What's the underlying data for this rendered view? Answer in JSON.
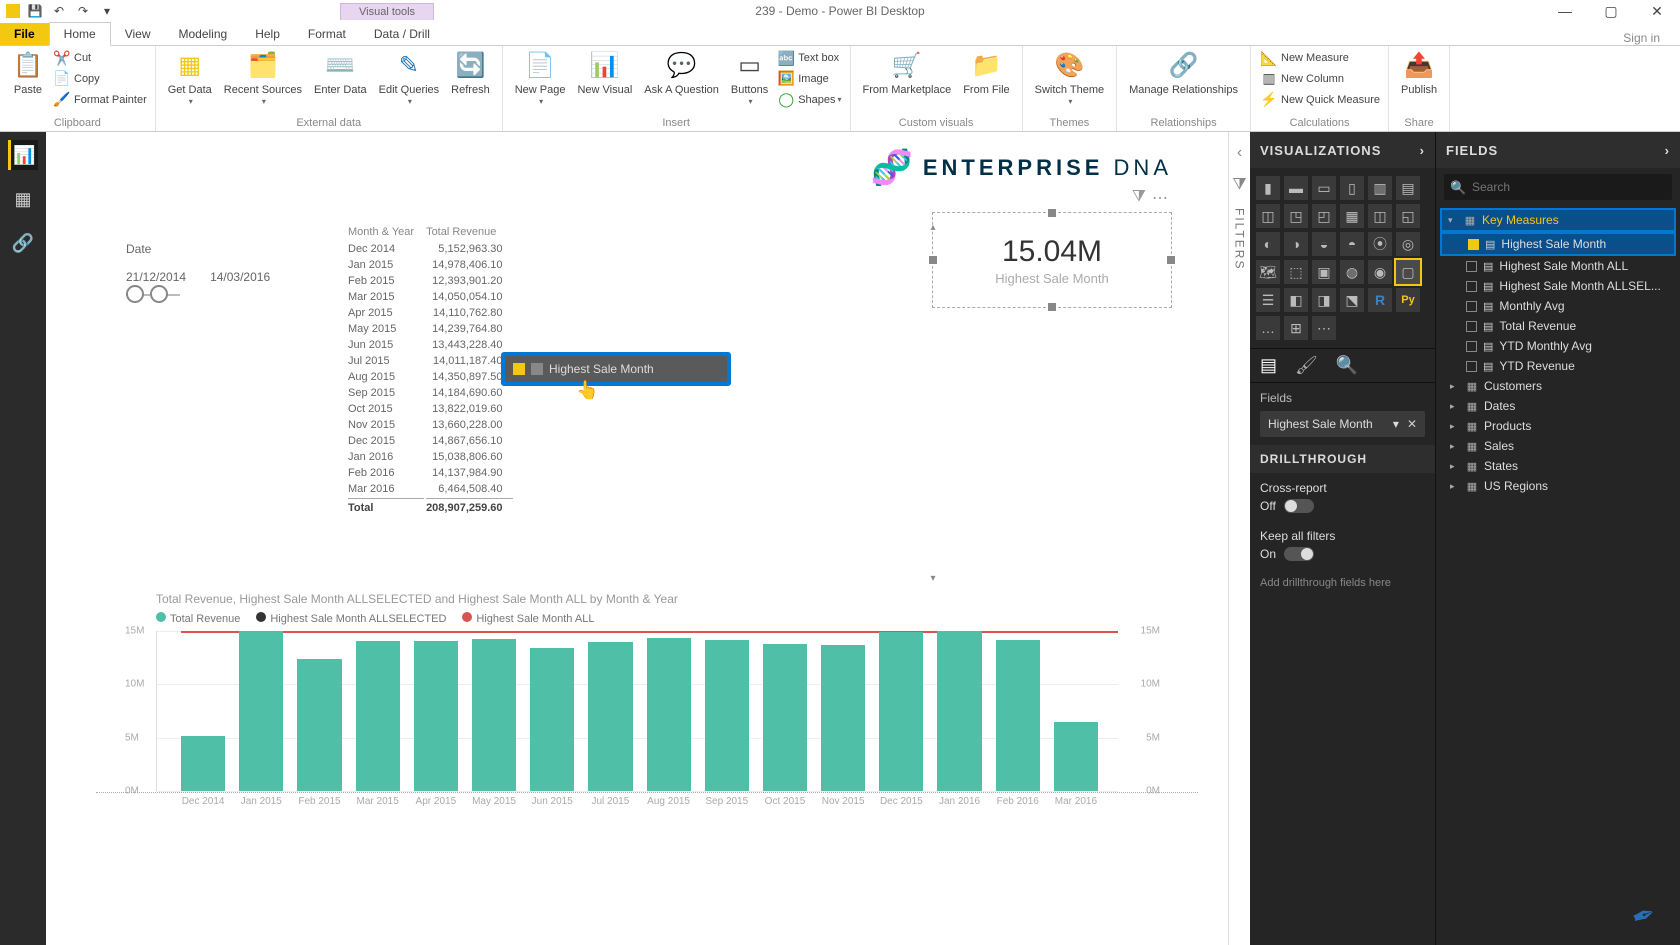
{
  "title": {
    "context": "Visual tools",
    "app": "239 - Demo - Power BI Desktop",
    "signin": "Sign in"
  },
  "tabs": {
    "file": "File",
    "home": "Home",
    "view": "View",
    "modeling": "Modeling",
    "help": "Help",
    "format": "Format",
    "data": "Data / Drill"
  },
  "ribbon": {
    "clipboard": {
      "label": "Clipboard",
      "paste": "Paste",
      "cut": "Cut",
      "copy": "Copy",
      "painter": "Format Painter"
    },
    "external": {
      "label": "External data",
      "getdata": "Get Data",
      "recent": "Recent Sources",
      "enter": "Enter Data",
      "edit": "Edit Queries",
      "refresh": "Refresh"
    },
    "insert": {
      "label": "Insert",
      "newpage": "New Page",
      "newvisual": "New Visual",
      "ask": "Ask A Question",
      "buttons": "Buttons",
      "textbox": "Text box",
      "image": "Image",
      "shapes": "Shapes"
    },
    "custom": {
      "label": "Custom visuals",
      "market": "From Marketplace",
      "file": "From File"
    },
    "themes": {
      "label": "Themes",
      "switch": "Switch Theme"
    },
    "rel": {
      "label": "Relationships",
      "manage": "Manage Relationships"
    },
    "calc": {
      "label": "Calculations",
      "measure": "New Measure",
      "column": "New Column",
      "quick": "New Quick Measure"
    },
    "share": {
      "label": "Share",
      "publish": "Publish"
    }
  },
  "slicer": {
    "title": "Date",
    "from": "21/12/2014",
    "to": "14/03/2016"
  },
  "table": {
    "h1": "Month & Year",
    "h2": "Total Revenue",
    "rows": [
      [
        "Dec 2014",
        "5,152,963.30"
      ],
      [
        "Jan 2015",
        "14,978,406.10"
      ],
      [
        "Feb 2015",
        "12,393,901.20"
      ],
      [
        "Mar 2015",
        "14,050,054.10"
      ],
      [
        "Apr 2015",
        "14,110,762.80"
      ],
      [
        "May 2015",
        "14,239,764.80"
      ],
      [
        "Jun 2015",
        "13,443,228.40"
      ],
      [
        "Jul 2015",
        "14,011,187.40"
      ],
      [
        "Aug 2015",
        "14,350,897.50"
      ],
      [
        "Sep 2015",
        "14,184,690.60"
      ],
      [
        "Oct 2015",
        "13,822,019.60"
      ],
      [
        "Nov 2015",
        "13,660,228.00"
      ],
      [
        "Dec 2015",
        "14,867,656.10"
      ],
      [
        "Jan 2016",
        "15,038,806.60"
      ],
      [
        "Feb 2016",
        "14,137,984.90"
      ],
      [
        "Mar 2016",
        "6,464,508.40"
      ]
    ],
    "total_lbl": "Total",
    "total_val": "208,907,259.60"
  },
  "brand": {
    "a": "ENTERPRISE",
    "b": "DNA"
  },
  "card": {
    "value": "15.04M",
    "label": "Highest Sale Month"
  },
  "drag": {
    "label": "Highest Sale Month"
  },
  "filters_tab": "FILTERS",
  "viz": {
    "header": "VISUALIZATIONS",
    "fields_lbl": "Fields",
    "well": "Highest Sale Month",
    "drill_header": "DRILLTHROUGH",
    "cross": "Cross-report",
    "cross_state": "Off",
    "keep": "Keep all filters",
    "keep_state": "On",
    "drop": "Add drillthrough fields here"
  },
  "fields": {
    "header": "FIELDS",
    "search_ph": "Search",
    "key_measures": "Key Measures",
    "measures": [
      {
        "name": "Highest Sale Month",
        "checked": true,
        "sel": true
      },
      {
        "name": "Highest Sale Month ALL",
        "checked": false
      },
      {
        "name": "Highest Sale Month ALLSEL...",
        "checked": false
      },
      {
        "name": "Monthly Avg",
        "checked": false
      },
      {
        "name": "Total Revenue",
        "checked": false
      },
      {
        "name": "YTD Monthly Avg",
        "checked": false
      },
      {
        "name": "YTD Revenue",
        "checked": false
      }
    ],
    "tables": [
      "Customers",
      "Dates",
      "Products",
      "Sales",
      "States",
      "US Regions"
    ]
  },
  "chart_data": {
    "type": "bar",
    "title": "Total Revenue, Highest Sale Month ALLSELECTED and Highest Sale Month ALL by Month & Year",
    "legend": [
      "Total Revenue",
      "Highest Sale Month ALLSELECTED",
      "Highest Sale Month ALL"
    ],
    "legend_colors": [
      "#4fbfa8",
      "#333333",
      "#d9534f"
    ],
    "categories": [
      "Dec 2014",
      "Jan 2015",
      "Feb 2015",
      "Mar 2015",
      "Apr 2015",
      "May 2015",
      "Jun 2015",
      "Jul 2015",
      "Aug 2015",
      "Sep 2015",
      "Oct 2015",
      "Nov 2015",
      "Dec 2015",
      "Jan 2016",
      "Feb 2016",
      "Mar 2016"
    ],
    "values": [
      5.15,
      14.98,
      12.39,
      14.05,
      14.11,
      14.24,
      13.44,
      14.01,
      14.35,
      14.18,
      13.82,
      13.66,
      14.87,
      15.04,
      14.14,
      6.46
    ],
    "y_ticks": [
      "0M",
      "5M",
      "10M",
      "15M"
    ],
    "ylim": [
      0,
      15
    ],
    "ref_line": 15.04,
    "xlabel": "",
    "ylabel": ""
  }
}
